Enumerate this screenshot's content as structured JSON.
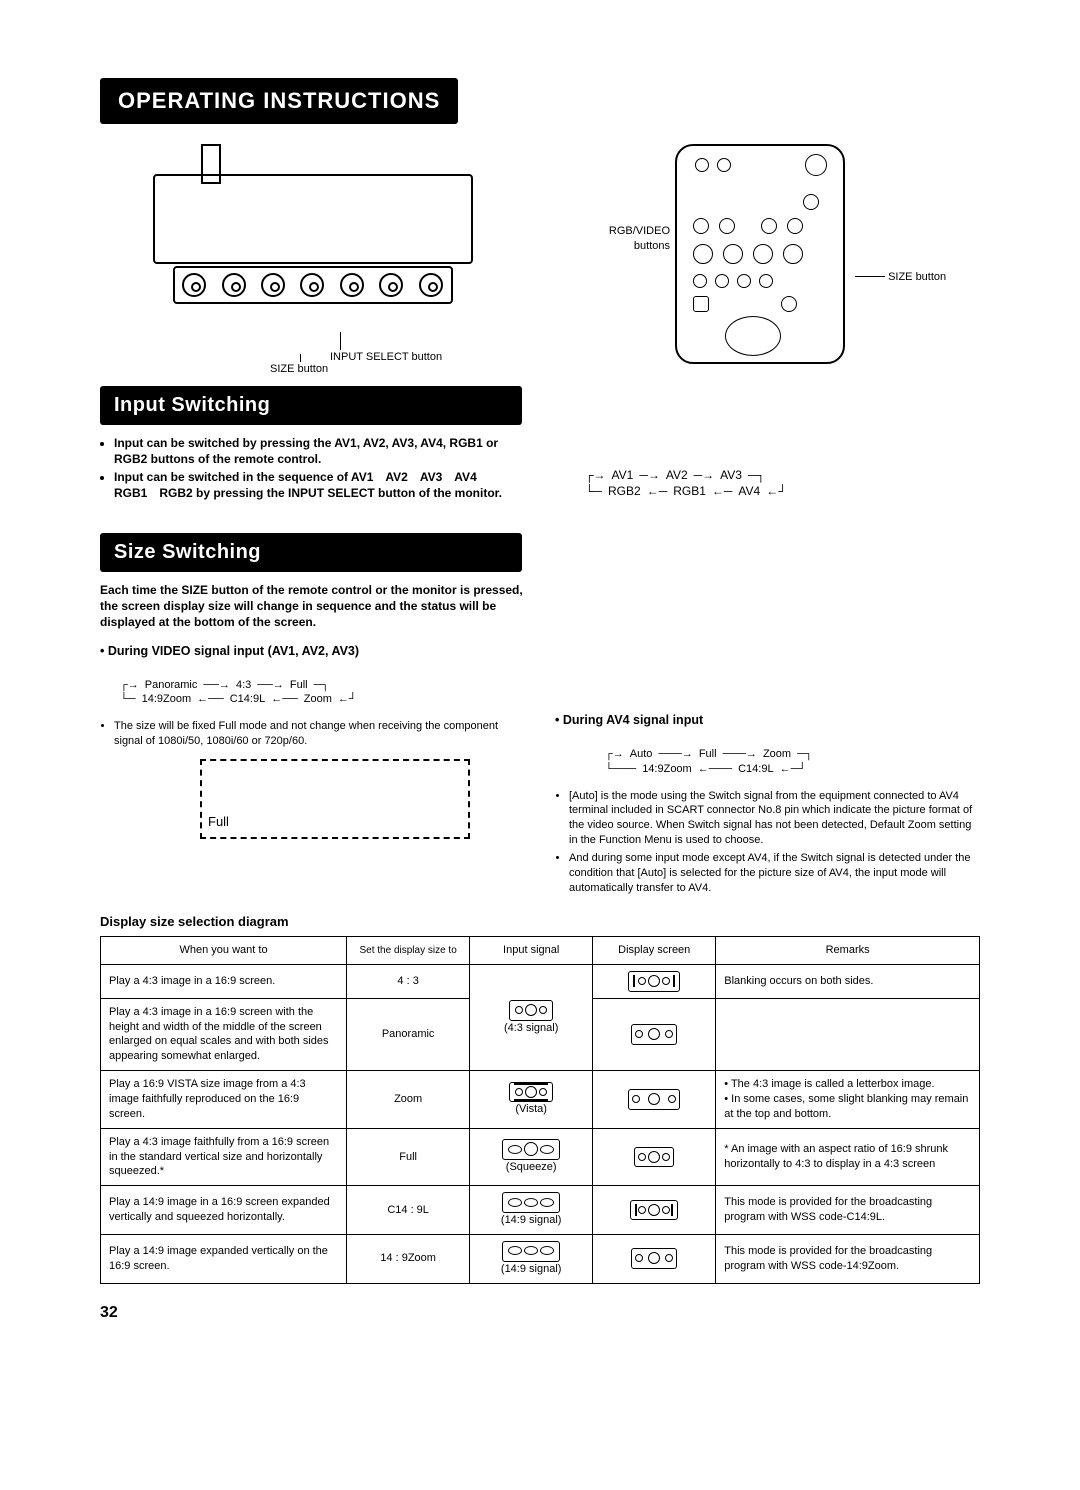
{
  "header": "OPERATING INSTRUCTIONS",
  "top_diagram": {
    "input_select_label": "INPUT SELECT button",
    "size_btn_label": "SIZE button",
    "rgb_video_label": "RGB/VIDEO buttons",
    "size_btn_label_remote": "SIZE button"
  },
  "sections": {
    "input_switching": {
      "title": "Input Switching",
      "bullets": [
        "Input can be switched by pressing the AV1, AV2, AV3, AV4, RGB1 or RGB2 buttons of the remote control.",
        "Input can be switched in the sequence of AV1 AV2 AV3 AV4 RGB1 RGB2 by pressing the INPUT SELECT button of the monitor."
      ],
      "sequence": [
        "AV1",
        "AV2",
        "AV3",
        "AV4",
        "RGB1",
        "RGB2"
      ]
    },
    "size_switching": {
      "title": "Size Switching",
      "intro": "Each time the SIZE button of the remote control or the monitor is pressed, the screen display size will change in sequence and the status will be displayed at the bottom of the screen.",
      "video_heading": "• During VIDEO signal input (AV1, AV2, AV3)",
      "video_sequence_top": [
        "Panoramic",
        "4:3",
        "Full"
      ],
      "video_sequence_bottom": [
        "14:9Zoom",
        "C14:9L",
        "Zoom"
      ],
      "video_note": "The size will be fixed Full mode and not change when receiving the component signal of 1080i/50, 1080i/60 or 720p/60.",
      "dash_label": "Full",
      "av4_heading": "• During AV4 signal input",
      "av4_sequence_top": [
        "Auto",
        "Full",
        "Zoom"
      ],
      "av4_sequence_bottom": [
        "14:9Zoom",
        "C14:9L"
      ],
      "av4_notes": [
        "[Auto] is the mode using the Switch signal from the equipment connected to AV4 terminal included in SCART connector No.8 pin which indicate the picture format of the video source. When Switch signal has not been detected, Default Zoom setting in the Function Menu is used to choose.",
        "And during some input mode except AV4, if the Switch signal is detected under the condition that [Auto] is selected for the picture size of AV4, the input mode will automatically transfer to AV4."
      ]
    }
  },
  "table": {
    "title": "Display size selection diagram",
    "headers": [
      "When you want to",
      "Set the display size to",
      "Input signal",
      "Display screen",
      "Remarks"
    ],
    "rows": [
      {
        "want": "Play a 4:3 image in a 16:9 screen.",
        "size": "4 : 3",
        "input": "(4:3 signal)",
        "remarks": "Blanking occurs on both sides.",
        "input_rowspan": 2
      },
      {
        "want": "Play a 4:3 image in a 16:9 screen with the height and width of the middle of the screen enlarged on equal scales and with both sides appearing somewhat enlarged.",
        "size": "Panoramic",
        "remarks": ""
      },
      {
        "want": "Play a 16:9 VISTA size image from a 4:3 image faithfully reproduced on the 16:9 screen.",
        "size": "Zoom",
        "input": "(Vista)",
        "remarks": "• The 4:3 image is called a letterbox image.\n• In some cases, some slight blanking may remain at the top and bottom."
      },
      {
        "want": "Play a 4:3 image faithfully from a 16:9 screen in the standard vertical size and horizontally squeezed.*",
        "size": "Full",
        "input": "(Squeeze)",
        "remarks": "* An image with an aspect ratio of 16:9 shrunk horizontally to 4:3 to display in a 4:3 screen"
      },
      {
        "want": "Play a 14:9 image in a 16:9 screen expanded vertically and squeezed horizontally.",
        "size": "C14 : 9L",
        "input": "(14:9 signal)",
        "remarks": "This mode is provided for the broadcasting program with WSS code-C14:9L."
      },
      {
        "want": "Play a 14:9 image expanded vertically on the 16:9 screen.",
        "size": "14 : 9Zoom",
        "input": "(14:9 signal)",
        "remarks": "This mode is provided for the broadcasting program with WSS code-14:9Zoom."
      }
    ]
  },
  "page_number": "32"
}
